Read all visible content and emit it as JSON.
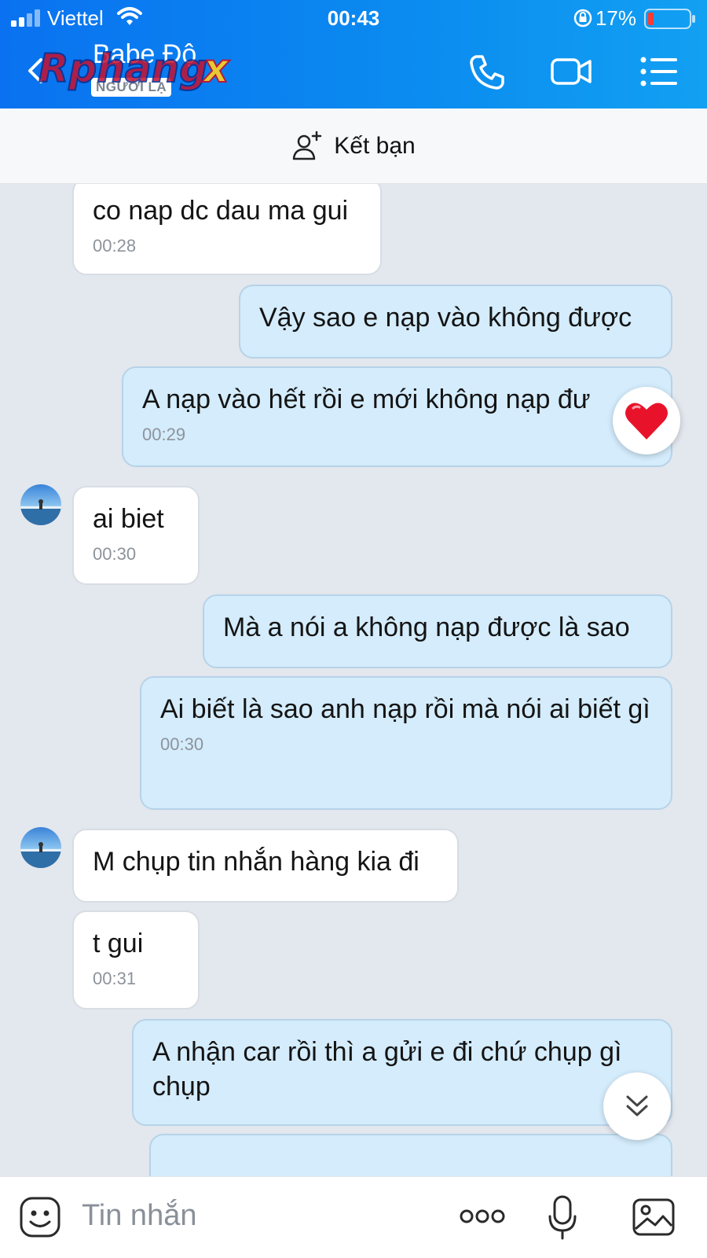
{
  "status_bar": {
    "carrier": "Viettel",
    "time": "00:43",
    "battery_percent": "17%"
  },
  "header": {
    "title": "Babe Độ",
    "badge": "NGƯỜI LẠ",
    "watermark": "Rphangx",
    "icons": [
      "back-chevron-icon",
      "phone-icon",
      "video-call-icon",
      "menu-list-icon"
    ]
  },
  "friend_bar": {
    "label": "Kết bạn",
    "icon": "add-friend-icon"
  },
  "messages": [
    {
      "dir": "in",
      "text": "co nap dc dau ma gui",
      "time": "00:28"
    },
    {
      "dir": "out",
      "text": "Vậy sao e nạp vào không được",
      "time": ""
    },
    {
      "dir": "out",
      "text": "A nạp vào hết rồi e mới không nạp đư",
      "time": "00:29",
      "reaction": "heart"
    },
    {
      "dir": "in",
      "text": "ai biet",
      "time": "00:30"
    },
    {
      "dir": "out",
      "text": "Mà a nói a không nạp được là sao",
      "time": ""
    },
    {
      "dir": "out",
      "text": "Ai biết là sao anh nạp rồi mà nói ai biết gì",
      "time": "00:30"
    },
    {
      "dir": "in",
      "text": "M chụp tin nhắn hàng kia đi",
      "time": ""
    },
    {
      "dir": "in",
      "text": "t gui",
      "time": "00:31"
    },
    {
      "dir": "out",
      "text": "A nhận car rồi thì a gửi e đi chứ chụp gì chụp",
      "time": ""
    }
  ],
  "input": {
    "placeholder": "Tin nhắn"
  },
  "colors": {
    "header_blue": "#0a72f0",
    "outgoing_bubble": "#d4ecfc",
    "incoming_bubble": "#ffffff",
    "chat_bg": "#e3e7ee"
  }
}
